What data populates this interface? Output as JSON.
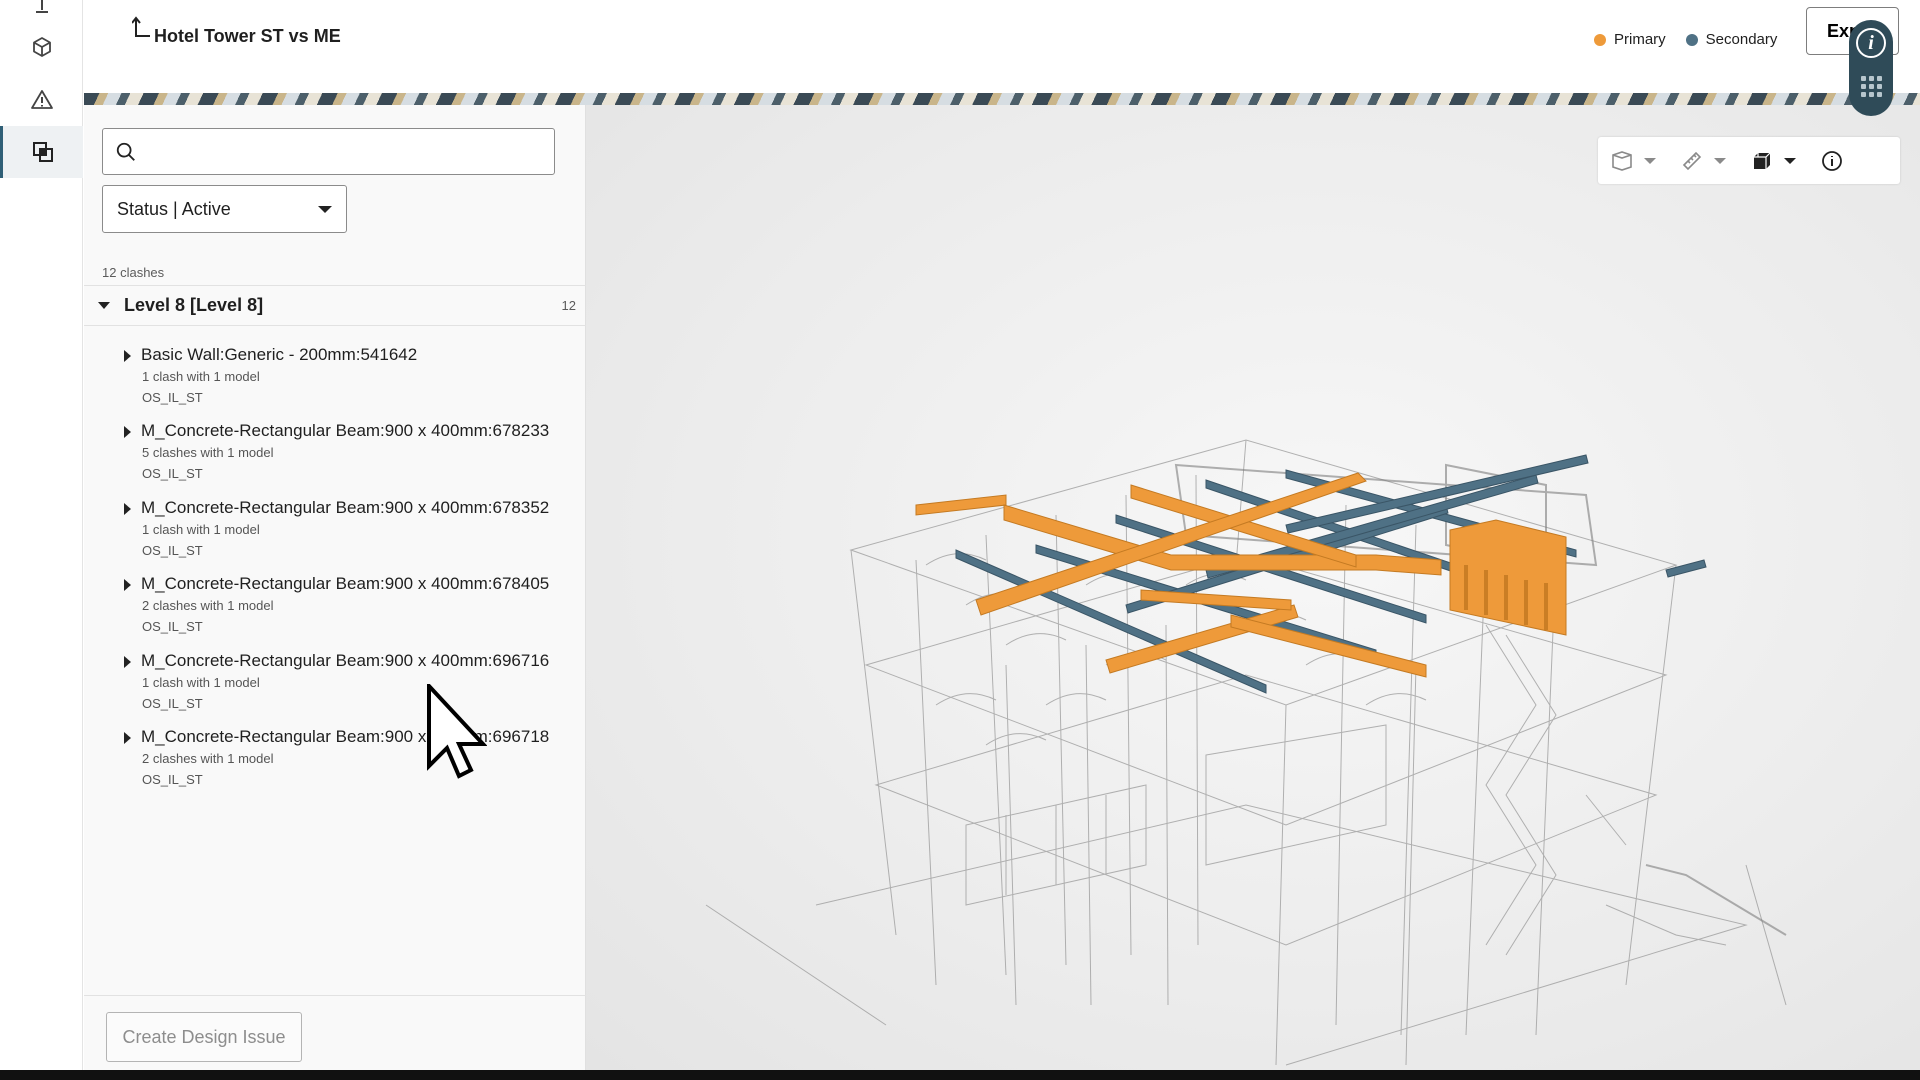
{
  "header": {
    "title": "Hotel Tower ST vs ME",
    "back_icon": "return-arrow-icon",
    "legend": [
      {
        "label": "Primary",
        "color": "#ee9a3a"
      },
      {
        "label": "Secondary",
        "color": "#4f7185"
      }
    ],
    "export_label": "Export"
  },
  "rail": {
    "items": [
      {
        "icon": "upload-icon"
      },
      {
        "icon": "cube-icon"
      },
      {
        "icon": "warning-icon"
      },
      {
        "icon": "clash-overlap-icon",
        "active": true
      }
    ]
  },
  "panel": {
    "search_placeholder": "",
    "status_filter": "Status | Active",
    "clash_count_text": "12 clashes",
    "group": {
      "label": "Level 8 [Level 8]",
      "count": "12"
    },
    "items": [
      {
        "name": "Basic Wall:Generic - 200mm:541642",
        "sub": "1 clash with 1 model",
        "model": "OS_IL_ST"
      },
      {
        "name": "M_Concrete-Rectangular Beam:900 x 400mm:678233",
        "sub": "5 clashes with 1 model",
        "model": "OS_IL_ST"
      },
      {
        "name": "M_Concrete-Rectangular Beam:900 x 400mm:678352",
        "sub": "1 clash with 1 model",
        "model": "OS_IL_ST"
      },
      {
        "name": "M_Concrete-Rectangular Beam:900 x 400mm:678405",
        "sub": "2 clashes with 1 model",
        "model": "OS_IL_ST"
      },
      {
        "name": "M_Concrete-Rectangular Beam:900 x 400mm:696716",
        "sub": "1 clash with 1 model",
        "model": "OS_IL_ST"
      },
      {
        "name": "M_Concrete-Rectangular Beam:900 x 400mm:696718",
        "sub": "2 clashes with 1 model",
        "model": "OS_IL_ST"
      }
    ],
    "create_label": "Create Design Issue"
  },
  "viewer": {
    "toolbar": [
      {
        "icon": "section-box-icon"
      },
      {
        "icon": "measure-ruler-icon"
      },
      {
        "icon": "view-cube-icon"
      },
      {
        "icon": "info-icon"
      }
    ],
    "colors": {
      "primary": "#ee9a3a",
      "secondary": "#4f7185"
    }
  }
}
